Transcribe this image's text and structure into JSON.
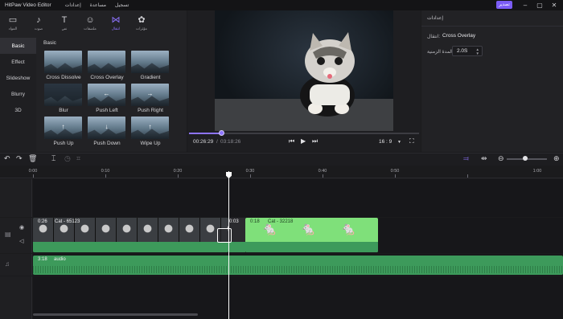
{
  "titlebar": {
    "app_title": "HitPaw Video Editor",
    "menus": [
      "إعدادات",
      "مساعدة",
      "تسجيل"
    ],
    "export_label": "تصدير"
  },
  "toolbar": {
    "tools": [
      {
        "label": "المواد",
        "icon": "media-icon",
        "glyph": "▭"
      },
      {
        "label": "صوت",
        "icon": "music-icon",
        "glyph": "♪"
      },
      {
        "label": "نص",
        "icon": "text-icon",
        "glyph": "T"
      },
      {
        "label": "ملصقات",
        "icon": "sticker-icon",
        "glyph": "☺"
      },
      {
        "label": "انتقال",
        "icon": "transition-icon",
        "glyph": "⋈",
        "active": true
      },
      {
        "label": "مؤثرات",
        "icon": "effects-icon",
        "glyph": "✿"
      }
    ]
  },
  "categories": [
    {
      "label": "Basic",
      "active": true
    },
    {
      "label": "Effect"
    },
    {
      "label": "Slideshow"
    },
    {
      "label": "Blurry"
    },
    {
      "label": "3D"
    }
  ],
  "transitions": {
    "heading": "Basic",
    "items": [
      "Cross Dissolve",
      "Cross Overlay",
      "Gradient",
      "Blur",
      "Push Left",
      "Push Right",
      "Push Up",
      "Push Down",
      "Wipe Up"
    ]
  },
  "preview": {
    "current_time": "00:26:29",
    "separator": "/",
    "total_time": "03:18:26",
    "aspect_ratio": "16 : 9",
    "progress_fraction": 0.14
  },
  "properties": {
    "title": "إعدادات",
    "transition_label": "انتقال:",
    "transition_value": "Cross Overlay",
    "duration_label": "المدة الزمنية",
    "duration_value": "2.0S"
  },
  "ruler": {
    "labels": [
      "0:00",
      "0:10",
      "0:20",
      "0:30",
      "0:40",
      "0:50",
      "1:00"
    ]
  },
  "timeline": {
    "clip1_duration": "0:26",
    "clip1_name": "Cat - 65123",
    "mid_duration": "0:03",
    "clip2_duration": "0:18",
    "clip2_name": "Cat - 32218",
    "audio_duration": "3:18",
    "audio_name": "audio"
  },
  "colors": {
    "accent": "#8e74ff",
    "clip_green": "#3d9a5b",
    "clip_lime": "#7fe07a"
  }
}
